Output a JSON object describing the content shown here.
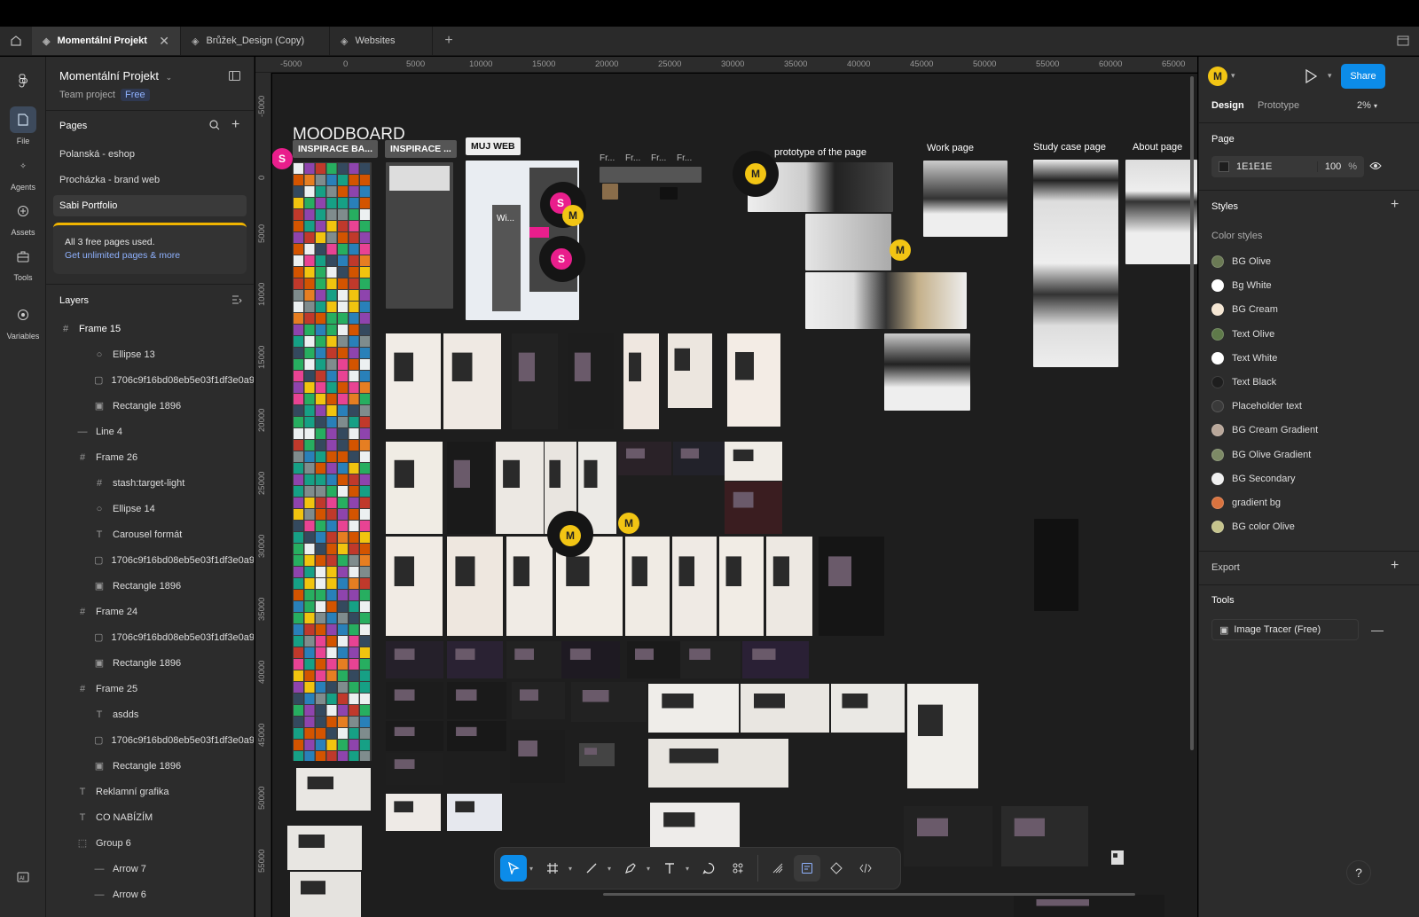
{
  "tabs": [
    {
      "label": "Momentální Projekt",
      "active": true,
      "close": "✕"
    },
    {
      "label": "Brůžek_Design (Copy)",
      "active": false
    },
    {
      "label": "Websites",
      "active": false
    }
  ],
  "rail": [
    {
      "label": "File",
      "icon": "file-icon"
    },
    {
      "label": "Agents",
      "icon": "agents-icon"
    },
    {
      "label": "Assets",
      "icon": "assets-icon"
    },
    {
      "label": "Tools",
      "icon": "tools-icon"
    },
    {
      "label": "Variables",
      "icon": "variables-icon"
    }
  ],
  "project": {
    "title": "Momentální Projekt",
    "team": "Team project",
    "plan": "Free"
  },
  "pages": {
    "header": "Pages",
    "items": [
      "Polanská - eshop",
      "Procházka - brand web",
      "Sabi Portfolio"
    ],
    "notice_text": "All 3 free pages used.",
    "notice_link": "Get unlimited pages & more"
  },
  "layers": {
    "header": "Layers",
    "items": [
      {
        "name": "Frame 15",
        "icon": "#",
        "indent": 0
      },
      {
        "name": "Ellipse 13",
        "icon": "○",
        "indent": 2
      },
      {
        "name": "1706c9f16bd08eb5e03f1df3e0a9",
        "icon": "▢",
        "indent": 2
      },
      {
        "name": "Rectangle 1896",
        "icon": "▣",
        "indent": 2
      },
      {
        "name": "Line 4",
        "icon": "—",
        "indent": 1
      },
      {
        "name": "Frame 26",
        "icon": "#",
        "indent": 1
      },
      {
        "name": "stash:target-light",
        "icon": "#",
        "indent": 2
      },
      {
        "name": "Ellipse 14",
        "icon": "○",
        "indent": 2
      },
      {
        "name": "Carousel formát",
        "icon": "T",
        "indent": 2
      },
      {
        "name": "1706c9f16bd08eb5e03f1df3e0a9",
        "icon": "▢",
        "indent": 2
      },
      {
        "name": "Rectangle 1896",
        "icon": "▣",
        "indent": 2
      },
      {
        "name": "Frame 24",
        "icon": "#",
        "indent": 1
      },
      {
        "name": "1706c9f16bd08eb5e03f1df3e0a9",
        "icon": "▢",
        "indent": 2
      },
      {
        "name": "Rectangle 1896",
        "icon": "▣",
        "indent": 2
      },
      {
        "name": "Frame 25",
        "icon": "#",
        "indent": 1
      },
      {
        "name": "asdds",
        "icon": "T",
        "indent": 2
      },
      {
        "name": "1706c9f16bd08eb5e03f1df3e0a9",
        "icon": "▢",
        "indent": 2
      },
      {
        "name": "Rectangle 1896",
        "icon": "▣",
        "indent": 2
      },
      {
        "name": "Reklamní grafika",
        "icon": "T",
        "indent": 1
      },
      {
        "name": "CO NABÍZÍM",
        "icon": "T",
        "indent": 1
      },
      {
        "name": "Group 6",
        "icon": "⬚",
        "indent": 1
      },
      {
        "name": "Arrow 7",
        "icon": "—",
        "indent": 2
      },
      {
        "name": "Arrow 6",
        "icon": "—",
        "indent": 2
      }
    ]
  },
  "ruler_x": [
    "-5000",
    "0",
    "5000",
    "10000",
    "15000",
    "20000",
    "25000",
    "30000",
    "35000",
    "40000",
    "45000",
    "50000",
    "55000",
    "60000",
    "65000"
  ],
  "ruler_y": [
    "-5000",
    "0",
    "5000",
    "10000",
    "15000",
    "20000",
    "25000",
    "30000",
    "35000",
    "40000",
    "45000",
    "50000",
    "55000"
  ],
  "canvas": {
    "moodboard": "MOODBOARD",
    "chips": [
      "INSPIRACE BA...",
      "INSPIRACE ...",
      "MUJ WEB"
    ],
    "small_frames": [
      "Fr...",
      "Fr...",
      "Fr...",
      "Fr..."
    ],
    "wi_label": "Wi...",
    "labels": [
      "prototype of the page",
      "Work page",
      "Study case page",
      "About page"
    ],
    "avatar_m": "M",
    "avatar_s": "S"
  },
  "right": {
    "user": "M",
    "share": "Share",
    "tab_design": "Design",
    "tab_prototype": "Prototype",
    "zoom": "2%",
    "page_header": "Page",
    "page_color": "1E1E1E",
    "page_opacity": "100",
    "percent": "%",
    "styles_header": "Styles",
    "color_styles": "Color styles",
    "styles": [
      {
        "name": "BG Olive",
        "color": "#6b7a55"
      },
      {
        "name": "Bg White",
        "color": "#ffffff"
      },
      {
        "name": "BG Cream",
        "color": "#f5e6d3"
      },
      {
        "name": "Text Olive",
        "color": "#5f7a4a"
      },
      {
        "name": "Text White",
        "color": "#ffffff"
      },
      {
        "name": "Text Black",
        "color": "#1e1e1e"
      },
      {
        "name": "Placeholder text",
        "color": "#3a3a3a"
      },
      {
        "name": "BG Cream Gradient",
        "color": "#b9a79a"
      },
      {
        "name": "BG Olive Gradient",
        "color": "#7d8a66"
      },
      {
        "name": "BG Secondary",
        "color": "#f0f0f0"
      },
      {
        "name": "gradient bg",
        "color": "#d9733f"
      },
      {
        "name": "BG color Olive",
        "color": "#c5c38c"
      }
    ],
    "export_header": "Export",
    "tools_header": "Tools",
    "tool_item": "Image Tracer (Free)"
  },
  "help": "?"
}
